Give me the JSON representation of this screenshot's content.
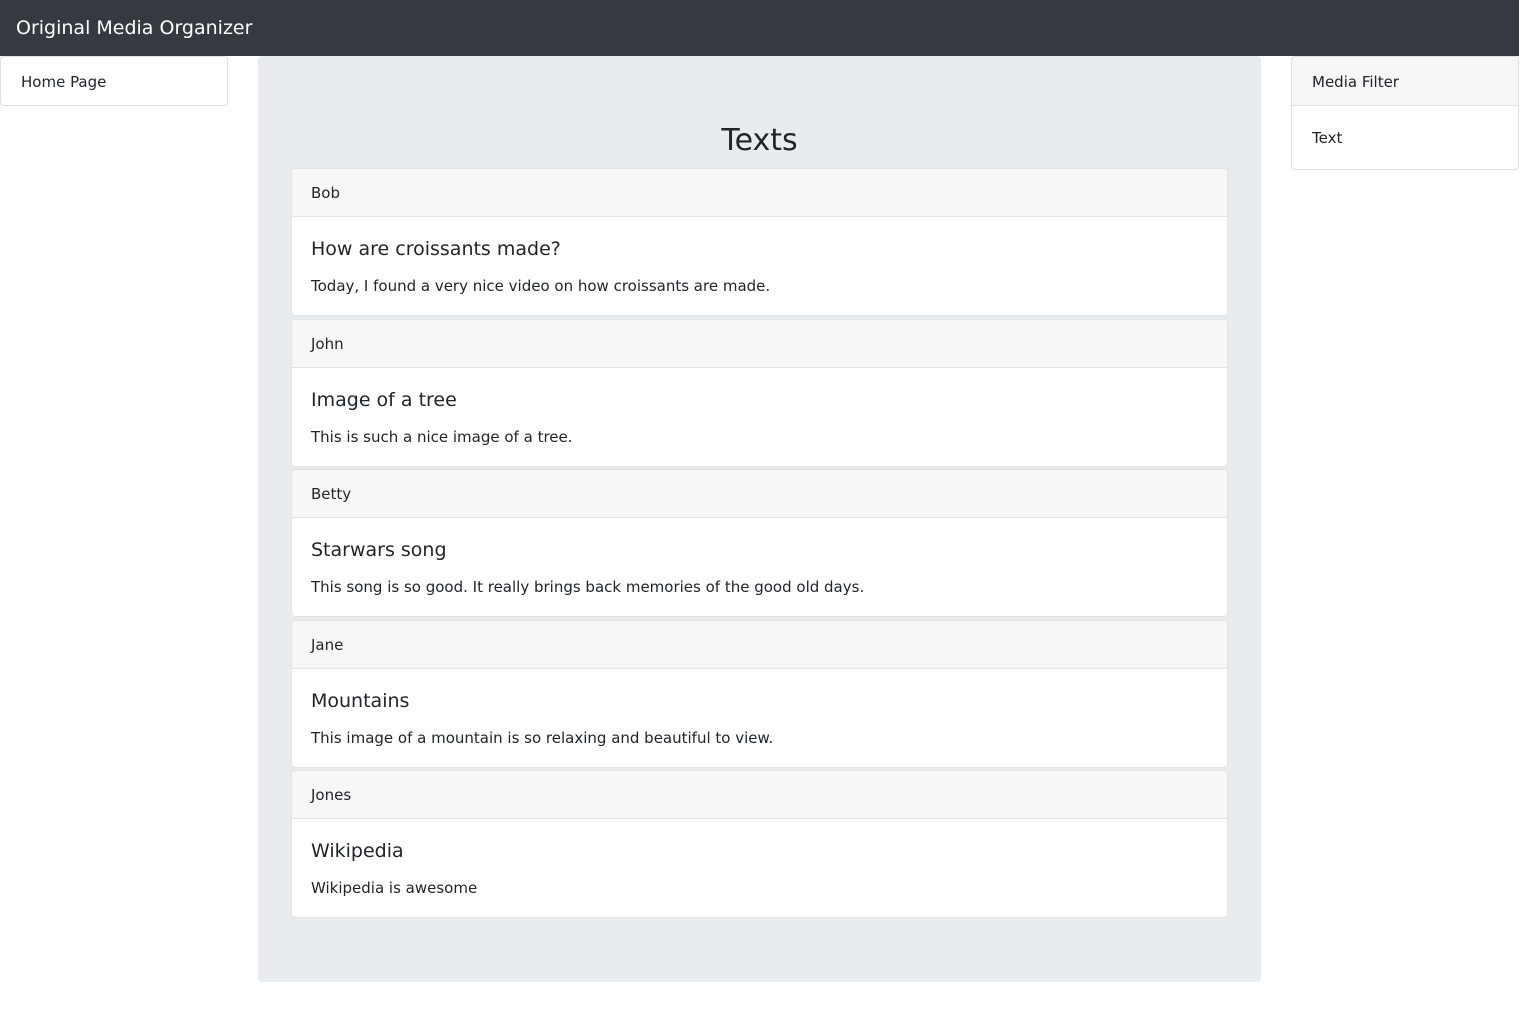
{
  "navbar": {
    "brand": "Original Media Organizer"
  },
  "left_nav": {
    "home_label": "Home Page"
  },
  "main": {
    "title": "Texts",
    "posts": [
      {
        "author": "Bob",
        "title": "How are croissants made?",
        "text": "Today, I found a very nice video on how croissants are made."
      },
      {
        "author": "John",
        "title": "Image of a tree",
        "text": "This is such a nice image of a tree."
      },
      {
        "author": "Betty",
        "title": "Starwars song",
        "text": "This song is so good. It really brings back memories of the good old days."
      },
      {
        "author": "Jane",
        "title": "Mountains",
        "text": "This image of a mountain is so relaxing and beautiful to view."
      },
      {
        "author": "Jones",
        "title": "Wikipedia",
        "text": "Wikipedia is awesome"
      }
    ]
  },
  "filter": {
    "title": "Media Filter",
    "options": [
      "Text"
    ]
  },
  "colors": {
    "navbar_bg": "#343a40",
    "main_panel_bg": "#e9ecef",
    "card_header_bg": "#f7f7f7"
  }
}
